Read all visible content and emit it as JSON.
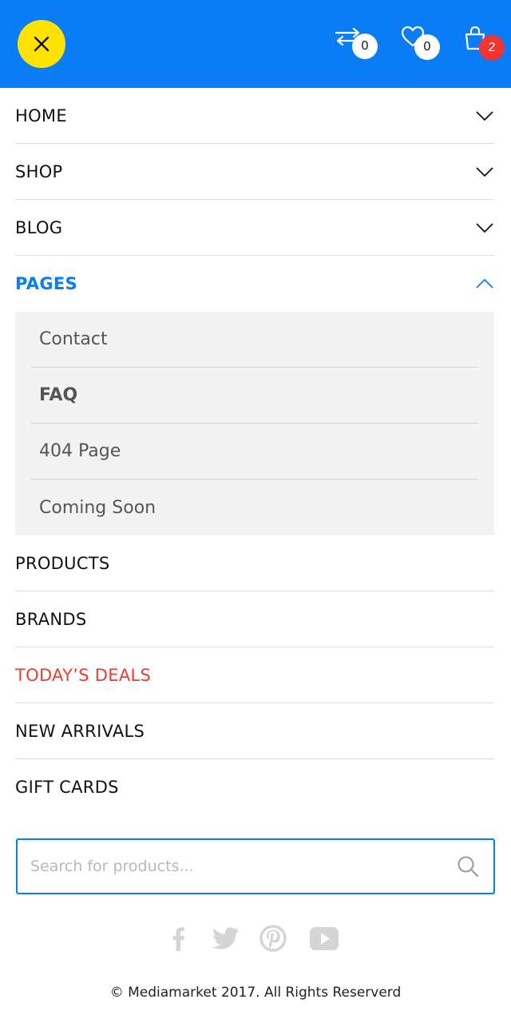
{
  "header": {
    "close_icon": "close-icon",
    "compare": {
      "icon": "compare-arrows-icon",
      "count": "0"
    },
    "wishlist": {
      "icon": "heart-icon",
      "count": "0"
    },
    "cart": {
      "icon": "shopping-bag-icon",
      "count": "2"
    }
  },
  "menu": {
    "items": [
      {
        "label": "HOME"
      },
      {
        "label": "SHOP"
      },
      {
        "label": "BLOG"
      },
      {
        "label": "PAGES"
      },
      {
        "label": "PRODUCTS"
      },
      {
        "label": "BRANDS"
      },
      {
        "label": "TODAY’S DEALS"
      },
      {
        "label": "NEW ARRIVALS"
      },
      {
        "label": "GIFT CARDS"
      }
    ],
    "pages_submenu": [
      {
        "label": "Contact"
      },
      {
        "label": "FAQ"
      },
      {
        "label": "404 Page"
      },
      {
        "label": "Coming Soon"
      }
    ]
  },
  "search": {
    "placeholder": "Search for products..."
  },
  "social": [
    "facebook-icon",
    "twitter-icon",
    "pinterest-icon",
    "youtube-icon"
  ],
  "footer": {
    "text": "© Mediamarket 2017. All Rights Reserverd"
  },
  "colors": {
    "brand_blue": "#0a7cf6",
    "accent_yellow": "#ffe300",
    "deal_red": "#ef3b30"
  }
}
